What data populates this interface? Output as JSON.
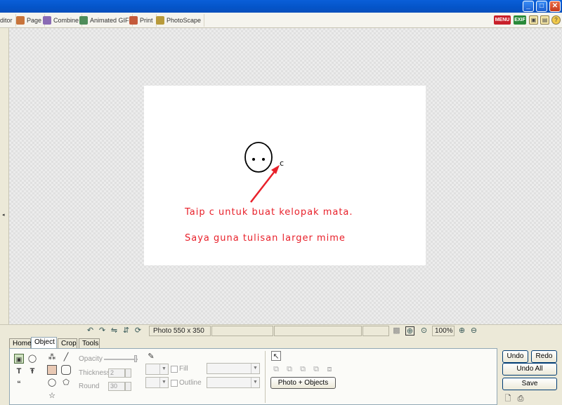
{
  "titlebar": {
    "minimize": "_",
    "maximize": "□",
    "close": "✕"
  },
  "top_tabs": [
    {
      "label": "ditor",
      "icon": "editor-icon",
      "color": "#6b8dbf"
    },
    {
      "label": "Page",
      "icon": "page-icon",
      "color": "#c8743a"
    },
    {
      "label": "Combine",
      "icon": "combine-icon",
      "color": "#8a6bb5"
    },
    {
      "label": "Animated GIF",
      "icon": "animated-gif-icon",
      "color": "#4f8d5a"
    },
    {
      "label": "Print",
      "icon": "print-icon",
      "color": "#c45a3a"
    },
    {
      "label": "PhotoScape",
      "icon": "photoscape-icon",
      "color": "#b89a3a"
    }
  ],
  "top_right": {
    "menu": "MENU",
    "exif": "EXIF",
    "menu_color": "#c8202a",
    "exif_color": "#2a8a3a"
  },
  "photo": {
    "line1": "Taip c untuk buat kelopak mata.",
    "line2": "Saya guna tulisan larger mime",
    "annotation_char": "c",
    "text_color": "#e8202a"
  },
  "status": {
    "photo_size": "Photo 550 x 350",
    "zoom": "100%"
  },
  "bottom_tabs": [
    "Home",
    "Object",
    "Crop",
    "Tools"
  ],
  "object_panel": {
    "opacity_label": "Opacity",
    "thickness_label": "Thickness",
    "thickness_value": "2",
    "round_label": "Round",
    "round_value": "30",
    "fill_label": "Fill",
    "outline_label": "Outline",
    "photo_objects_button": "Photo + Objects"
  },
  "actions": {
    "undo": "Undo",
    "redo": "Redo",
    "undo_all": "Undo All",
    "save": "Save"
  }
}
